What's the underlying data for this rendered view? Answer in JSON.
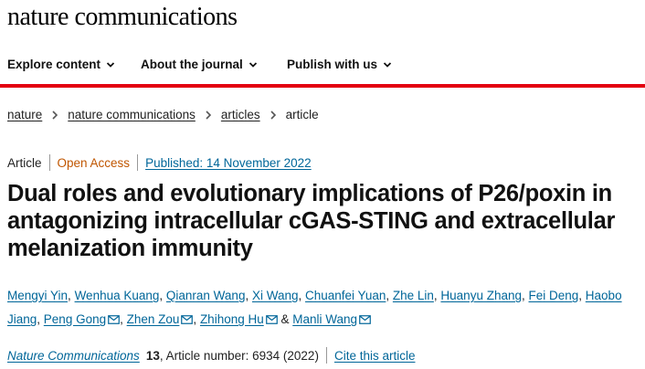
{
  "site": {
    "logo": "nature communications"
  },
  "nav": {
    "items": [
      {
        "label": "Explore content"
      },
      {
        "label": "About the journal"
      },
      {
        "label": "Publish with us"
      }
    ],
    "accent_color": "#e3000f"
  },
  "breadcrumb": [
    "nature",
    "nature communications",
    "articles",
    "article"
  ],
  "article_meta": {
    "type": "Article",
    "access": "Open Access",
    "published": "Published: 14 November 2022"
  },
  "article": {
    "title": "Dual roles and evolutionary implications of P26/poxin in antagonizing intracellular cGAS-STING and extracellular melanization immunity"
  },
  "authors": [
    {
      "name": "Mengyi Yin",
      "sep": ", "
    },
    {
      "name": "Wenhua Kuang",
      "sep": ", "
    },
    {
      "name": "Qianran Wang",
      "sep": ", "
    },
    {
      "name": "Xi Wang",
      "sep": ", "
    },
    {
      "name": "Chuanfei Yuan",
      "sep": ", "
    },
    {
      "name": "Zhe Lin",
      "sep": ", "
    },
    {
      "name": "Huanyu Zhang",
      "sep": ", "
    },
    {
      "name": "Fei Deng",
      "sep": ", "
    },
    {
      "name": "Haobo Jiang",
      "sep": ", "
    },
    {
      "name": "Peng Gong",
      "sep": ", "
    },
    {
      "name": "Zhen Zou",
      "sep": ", "
    },
    {
      "name": "Zhihong Hu",
      "sep": " & "
    },
    {
      "name": "Manli Wang",
      "sep": ""
    }
  ],
  "citation": {
    "journal": "Nature Communications",
    "volume": "13",
    "details": ", Article number: 6934 (2022)",
    "cite_link": "Cite this article"
  }
}
